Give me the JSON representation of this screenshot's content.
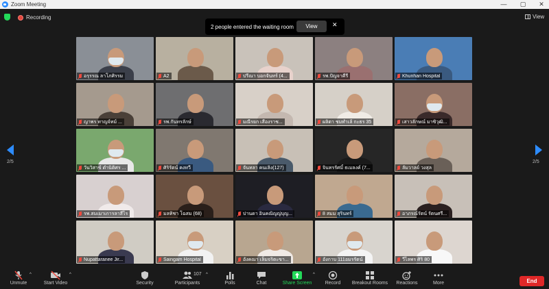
{
  "window": {
    "title": "Zoom Meeting",
    "controls": [
      "—",
      "▢",
      "✕"
    ]
  },
  "top": {
    "recording_label": "Recording",
    "view_label": "View"
  },
  "banner": {
    "message": "2 people entered the waiting room",
    "view_button": "View",
    "close": "✕"
  },
  "pagination": {
    "left_page": "2/5",
    "right_page": "2/5"
  },
  "participants": [
    {
      "name": "อรุรรณ ลาโภศิรรม",
      "wall": "#8a8f96",
      "body": "#3b3f4a",
      "mask": true
    },
    {
      "name": "A2",
      "wall": "#b8b0a0",
      "body": "#6b5a4a",
      "mask": false
    },
    {
      "name": "ปรีณา บอกจันทร์ (4...",
      "wall": "#c9c2ba",
      "body": "#e8d2cc",
      "mask": false
    },
    {
      "name": "รพ.ปัญจาคีรี",
      "wall": "#8c8080",
      "body": "#9a7070",
      "mask": false
    },
    {
      "name": "Khunhan Hospital",
      "wall": "#4a7db5",
      "body": "#3a5a80",
      "mask": false
    },
    {
      "name": "ญาพร ทาญจ์ทม์ ...",
      "wall": "#a59a8e",
      "body": "#4a4038",
      "mask": false
    },
    {
      "name": "รพ.กันทรลักษ์",
      "wall": "#6e6e70",
      "body": "#2a2a30",
      "mask": false
    },
    {
      "name": "มณีรยก เสืองราช...",
      "wall": "#d8d0c8",
      "body": "#c4b8b0",
      "mask": false
    },
    {
      "name": "ผลิตา ชมทำเล้ กะธร 35",
      "wall": "#d6d0c8",
      "body": "#f0ece6",
      "mask": false
    },
    {
      "name": "เสาวลักษณ์ มาซิวุฒิ...",
      "wall": "#8a6e64",
      "body": "#3a2a2a",
      "mask": true
    },
    {
      "name": "วันวิสาข์ ดำนิติศร ...",
      "wall": "#7aa86e",
      "body": "#e8e8e8",
      "mask": true
    },
    {
      "name": "ศิริรัตน์ คงทวี",
      "wall": "#807870",
      "body": "#3a5a80",
      "mask": false
    },
    {
      "name": "จันทลา คนเลิง(127)",
      "wall": "#c8c0b6",
      "body": "#4a5a6a",
      "mask": false
    },
    {
      "name": "จินทรรัศมิ์ ธเมลงค์ (7...",
      "wall": "#262626",
      "body": "#1a1a1a",
      "mask": false
    },
    {
      "name": "ลัมวาลย์ วงสุล",
      "wall": "#b5a99c",
      "body": "#6a6058",
      "mask": false
    },
    {
      "name": "รพ.สมเมาเการลาสีไร",
      "wall": "#d8d0d0",
      "body": "#f0eaea",
      "mask": false
    },
    {
      "name": "มลทิชา โฉสม (68)",
      "wall": "#6a5040",
      "body": "#2a1f1a",
      "mask": false
    },
    {
      "name": "ปานดา อินคณิญญ่บุญ...",
      "wall": "#1e1e24",
      "body": "#2a2a40",
      "mask": false
    },
    {
      "name": "8 สมม สุรินทร์",
      "wall": "#c0a890",
      "body": "#3a6a90",
      "mask": false
    },
    {
      "name": "อาภรณ์รัตน์ รัตนศรี...",
      "wall": "#c8c0b8",
      "body": "#2a2020",
      "mask": false
    },
    {
      "name": "Nupattaranee Jir...",
      "wall": "#d0ccc4",
      "body": "#3a3a50",
      "mask": false
    },
    {
      "name": "Saingam Hospital",
      "wall": "#d8d0c4",
      "body": "#f2f2f2",
      "mask": true
    },
    {
      "name": "อังคณา เล็มจริตะขา...",
      "wall": "#b8a690",
      "body": "#f0eae6",
      "mask": false
    },
    {
      "name": "อังกาบ 111อมรรัตน์",
      "wall": "#d8d4ce",
      "body": "#f4f4f4",
      "mask": true
    },
    {
      "name": "วีไลพร ศิริ 80",
      "wall": "#ddd6d0",
      "body": "#f8f8f8",
      "mask": false
    }
  ],
  "toolbar": {
    "unmute": "Unmute",
    "start_video": "Start Video",
    "security": "Security",
    "participants": "Participants",
    "participants_count": "107",
    "polls": "Polls",
    "chat": "Chat",
    "share_screen": "Share Screen",
    "record": "Record",
    "breakout_rooms": "Breakout Rooms",
    "reactions": "Reactions",
    "more": "More",
    "end": "End"
  },
  "colors": {
    "accent": "#2d8cff",
    "share_green": "#23d959",
    "end_red": "#e02828",
    "muted_red": "#f04a3e"
  }
}
